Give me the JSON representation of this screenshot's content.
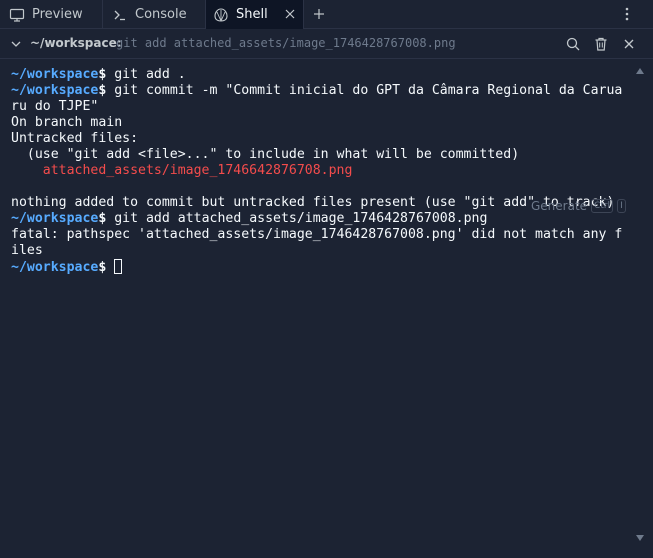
{
  "tabs": [
    {
      "label": "Preview",
      "icon": "monitor-icon"
    },
    {
      "label": "Console",
      "icon": "terminal-prompt-icon"
    },
    {
      "label": "Shell",
      "icon": "shell-icon",
      "active": true
    }
  ],
  "header": {
    "cwd": "~/workspace:",
    "last_command": "git add attached_assets/image_1746428767008.png"
  },
  "terminal": {
    "prompt_path": "~/workspace",
    "prompt_sign": "$",
    "lines": [
      {
        "kind": "prompt",
        "cmd": " git add ."
      },
      {
        "kind": "prompt",
        "cmd": " git commit -m \"Commit inicial do GPT da Câmara Regional da Carua"
      },
      {
        "kind": "out",
        "text": "ru do TJPE\""
      },
      {
        "kind": "out",
        "text": "On branch main"
      },
      {
        "kind": "out",
        "text": "Untracked files:"
      },
      {
        "kind": "out",
        "text": "  (use \"git add <file>...\" to include in what will be committed)"
      },
      {
        "kind": "red",
        "text": "    attached_assets/image_1746642876708.png"
      },
      {
        "kind": "out",
        "text": ""
      },
      {
        "kind": "out",
        "text": "nothing added to commit but untracked files present (use \"git add\" to track)"
      },
      {
        "kind": "prompt",
        "cmd": " git add attached_assets/image_1746428767008.png"
      },
      {
        "kind": "out",
        "text": "fatal: pathspec 'attached_assets/image_1746428767008.png' did not match any f"
      },
      {
        "kind": "out",
        "text": "iles"
      },
      {
        "kind": "prompt",
        "cmd": " ",
        "cursor": true
      }
    ]
  },
  "generate": {
    "label": "Generate",
    "key1": "Ctrl",
    "key2": "I"
  },
  "colors": {
    "background": "#1c2333",
    "prompt": "#57abff",
    "error_file": "#f44c4c"
  }
}
